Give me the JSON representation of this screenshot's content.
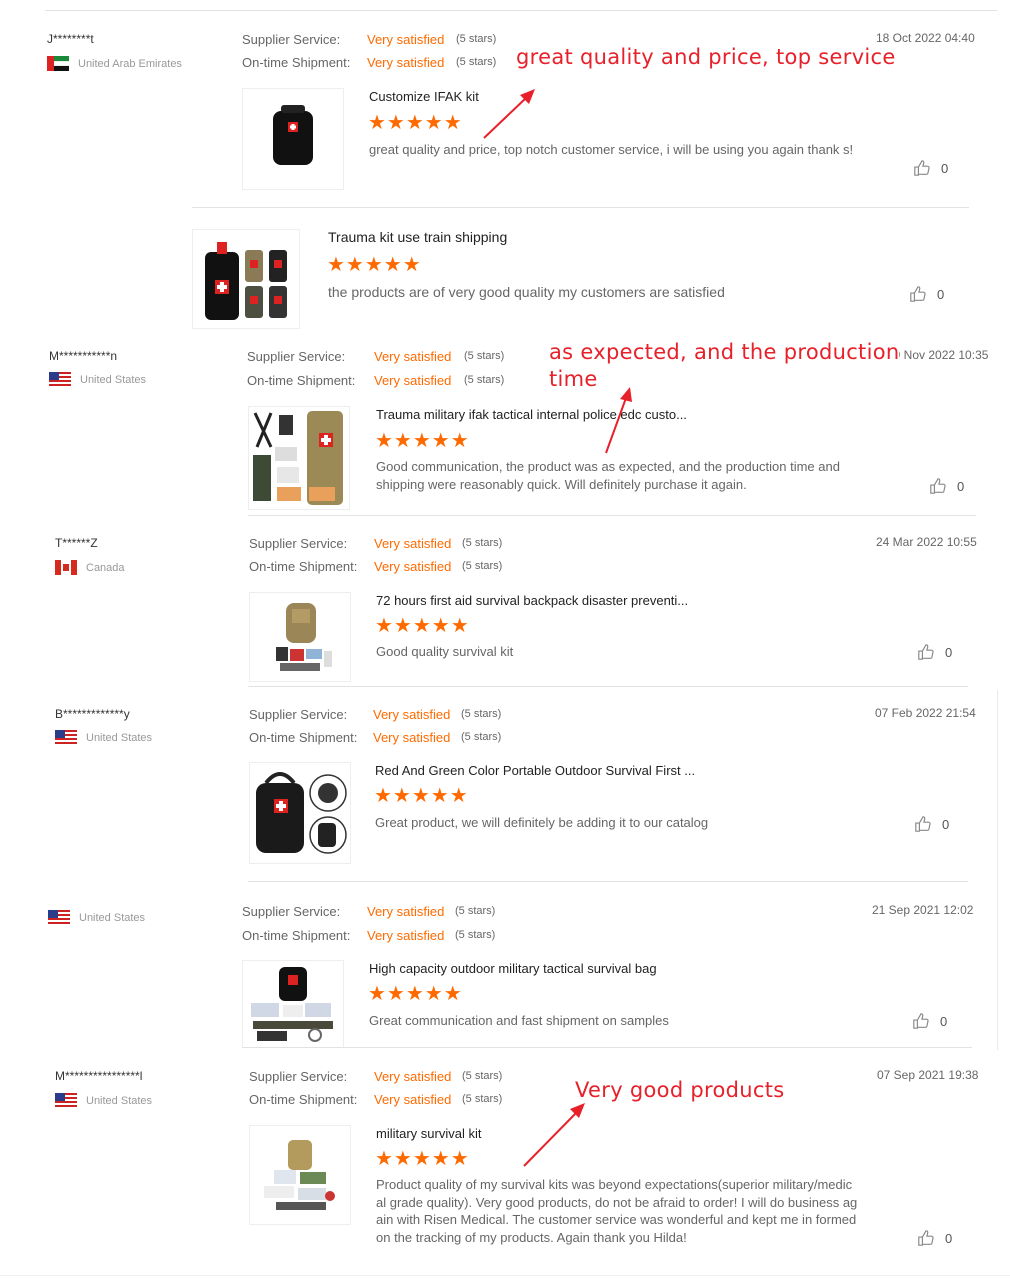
{
  "labels": {
    "supplier_service": "Supplier Service:",
    "ontime_shipment": "On-time Shipment:"
  },
  "reviews": [
    {
      "name": "J********t",
      "country": "United Arab Emirates",
      "flag": "ae",
      "supplier_rating": "Very satisfied",
      "supplier_stars": "(5 stars)",
      "shipment_rating": "Very satisfied",
      "shipment_stars": "(5 stars)",
      "date": "18 Oct 2022 04:40",
      "items": [
        {
          "title": "Customize IFAK kit",
          "stars": 5,
          "comment": "great quality and price, top notch customer service, i will be using you again thank s!",
          "likes": "0"
        },
        {
          "title": "Trauma kit use train shipping",
          "stars": 5,
          "comment": "the products are of very good quality my customers are satisfied",
          "likes": "0"
        }
      ]
    },
    {
      "name": "M***********n",
      "country": "United States",
      "flag": "us",
      "supplier_rating": "Very satisfied",
      "supplier_stars": "(5 stars)",
      "shipment_rating": "Very satisfied",
      "shipment_stars": "(5 stars)",
      "date": "09 Nov 2022 10:35",
      "items": [
        {
          "title": "Trauma military ifak tactical internal police edc custo...",
          "stars": 5,
          "comment": "Good communication, the product was as expected, and the production time and shipping were reasonably quick.  Will definitely purchase it again.",
          "likes": "0"
        }
      ]
    },
    {
      "name": "T******Z",
      "country": "Canada",
      "flag": "ca",
      "supplier_rating": "Very satisfied",
      "supplier_stars": "(5 stars)",
      "shipment_rating": "Very satisfied",
      "shipment_stars": "(5 stars)",
      "date": "24 Mar 2022 10:55",
      "items": [
        {
          "title": "72 hours first aid survival backpack disaster preventi...",
          "stars": 5,
          "comment": "Good quality survival kit",
          "likes": "0"
        }
      ]
    },
    {
      "name": "B*************y",
      "country": "United States",
      "flag": "us",
      "supplier_rating": "Very satisfied",
      "supplier_stars": "(5 stars)",
      "shipment_rating": "Very satisfied",
      "shipment_stars": "(5 stars)",
      "date": "07 Feb 2022 21:54",
      "items": [
        {
          "title": "Red And Green Color Portable Outdoor Survival First ...",
          "stars": 5,
          "comment": "Great product, we will definitely be adding it to our catalog",
          "likes": "0"
        }
      ]
    },
    {
      "name": "",
      "country": "United States",
      "flag": "us",
      "supplier_rating": "Very satisfied",
      "supplier_stars": "(5 stars)",
      "shipment_rating": "Very satisfied",
      "shipment_stars": "(5 stars)",
      "date": "21 Sep 2021 12:02",
      "items": [
        {
          "title": "High capacity outdoor military tactical survival bag",
          "stars": 5,
          "comment": "Great communication and fast shipment on samples",
          "likes": "0"
        }
      ]
    },
    {
      "name": "M****************l",
      "country": "United States",
      "flag": "us",
      "supplier_rating": "Very satisfied",
      "supplier_stars": "(5 stars)",
      "shipment_rating": "Very satisfied",
      "shipment_stars": "(5 stars)",
      "date": "07 Sep 2021 19:38",
      "items": [
        {
          "title": "military survival kit",
          "stars": 5,
          "comment": "Product quality of my survival kits was beyond expectations(superior military/medical grade quality). Very good products, do not be afraid to order! I will do business again with Risen Medical. The customer service was wonderful and kept me in formed on the tracking of my products. Again thank you Hilda!",
          "likes": "0"
        }
      ]
    }
  ],
  "annotations": {
    "a1": "great quality and price, top service",
    "a2_line1": "as expected, and the production",
    "a2_line2": "time",
    "a3": "Very good products"
  },
  "colors": {
    "accent": "#ff6a00",
    "annotation": "#e8202a"
  }
}
